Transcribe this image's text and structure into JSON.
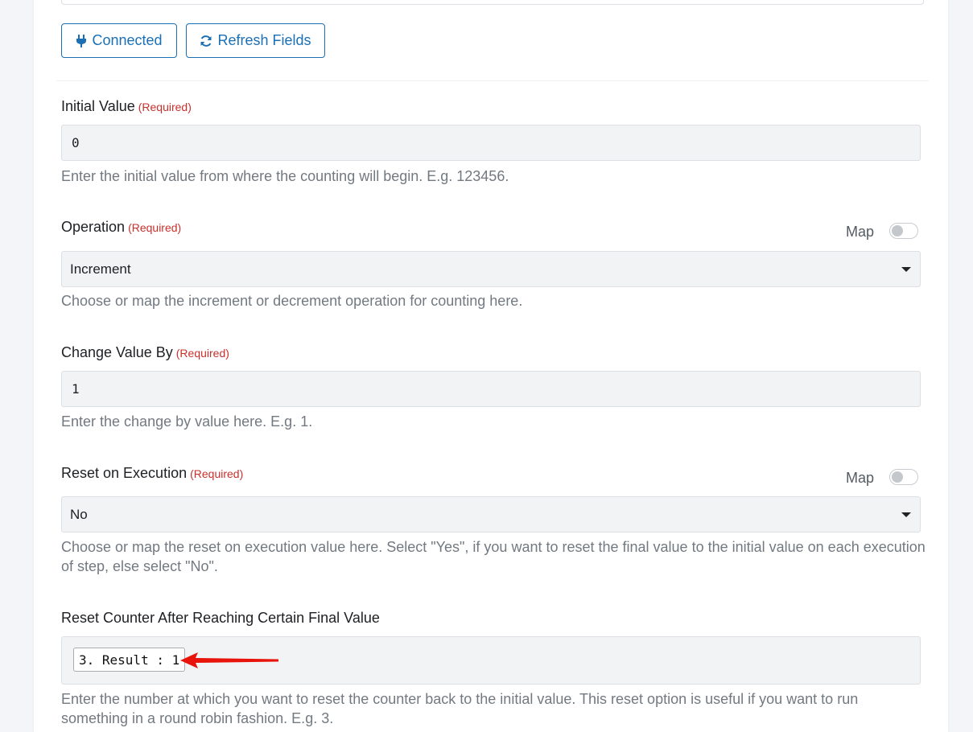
{
  "toolbar": {
    "connected_label": "Connected",
    "refresh_label": "Refresh Fields"
  },
  "fields": {
    "initial_value": {
      "label": "Initial Value",
      "required": "(Required)",
      "value": "0",
      "help": "Enter the initial value from where the counting will begin. E.g. 123456."
    },
    "operation": {
      "label": "Operation",
      "required": "(Required)",
      "map_label": "Map",
      "value": "Increment",
      "help": "Choose or map the increment or decrement operation for counting here."
    },
    "change_value_by": {
      "label": "Change Value By",
      "required": "(Required)",
      "value": "1",
      "help": "Enter the change by value here. E.g. 1."
    },
    "reset_on_execution": {
      "label": "Reset on Execution",
      "required": "(Required)",
      "map_label": "Map",
      "value": "No",
      "help": "Choose or map the reset on execution value here. Select \"Yes\", if you want to reset the final value to the initial value on each execution of step, else select \"No\"."
    },
    "reset_counter": {
      "label": "Reset Counter After Reaching Certain Final Value",
      "chip": "3. Result : 1",
      "help": "Enter the number at which you want to reset the counter back to the initial value. This reset option is useful if you want to run something in a round robin fashion. E.g. 3."
    }
  },
  "colors": {
    "accent": "#1a6fb5",
    "required": "#c9302c",
    "annotation_arrow": "#e8140c"
  },
  "icons": {
    "connected": "plug-icon",
    "refresh": "refresh-icon",
    "dropdown": "caret-down-icon",
    "annotation": "red-arrow-icon"
  },
  "toggles": {
    "operation_map": false,
    "reset_on_execution_map": false
  }
}
